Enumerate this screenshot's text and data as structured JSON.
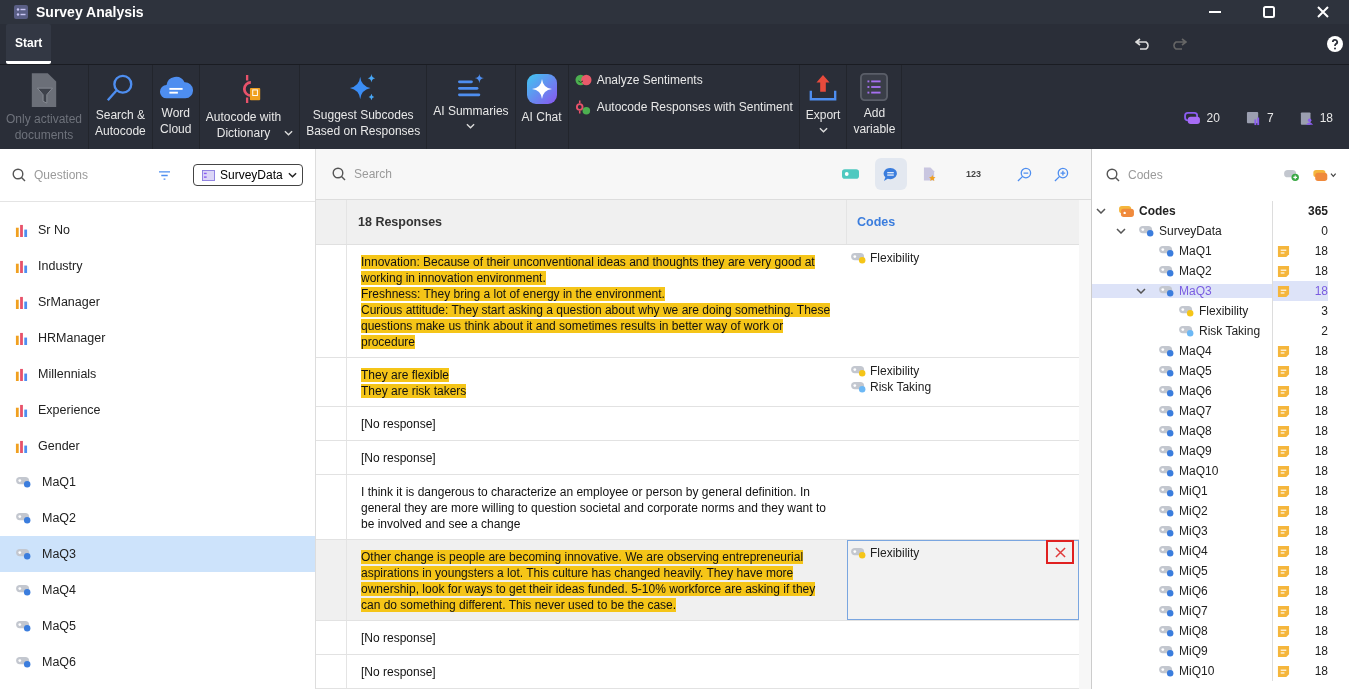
{
  "window": {
    "title": "Survey Analysis"
  },
  "tabs": [
    {
      "label": "Start",
      "selected": true
    }
  ],
  "ribbon": [
    {
      "kind": "big",
      "label": "Only activated\ndocuments",
      "disabled": true,
      "dropdown": false
    },
    {
      "kind": "big",
      "label": "Search &\nAutocode",
      "disabled": false,
      "dropdown": false
    },
    {
      "kind": "big",
      "label": "Word\nCloud",
      "disabled": false,
      "dropdown": false
    },
    {
      "kind": "big",
      "label": "Autocode with\nDictionary",
      "disabled": false,
      "dropdown": true
    },
    {
      "kind": "big",
      "label": "Suggest Subcodes\nBased on Responses",
      "disabled": false,
      "dropdown": false
    },
    {
      "kind": "big",
      "label": "AI Summaries",
      "disabled": false,
      "dropdown": true
    },
    {
      "kind": "big",
      "label": "AI Chat",
      "disabled": false,
      "dropdown": false
    },
    {
      "kind": "stack",
      "items": [
        "Analyze Sentiments",
        "Autocode Responses with Sentiment"
      ]
    },
    {
      "kind": "big",
      "label": "Export",
      "disabled": false,
      "dropdown": true
    },
    {
      "kind": "big",
      "label": "Add\nvariable",
      "disabled": false,
      "dropdown": false
    }
  ],
  "stats": [
    "20",
    "7",
    "18"
  ],
  "left_panel": {
    "search": {
      "placeholder": "Questions"
    },
    "dropdown": "SurveyData",
    "items": [
      {
        "label": "Sr No",
        "kind": "variable",
        "selected": false
      },
      {
        "label": "Industry",
        "kind": "variable",
        "selected": false
      },
      {
        "label": "SrManager",
        "kind": "variable",
        "selected": false
      },
      {
        "label": "HRManager",
        "kind": "variable",
        "selected": false
      },
      {
        "label": "Millennials",
        "kind": "variable",
        "selected": false
      },
      {
        "label": "Experience",
        "kind": "variable",
        "selected": false
      },
      {
        "label": "Gender",
        "kind": "variable",
        "selected": false
      },
      {
        "label": "MaQ1",
        "kind": "code",
        "selected": false
      },
      {
        "label": "MaQ2",
        "kind": "code",
        "selected": false
      },
      {
        "label": "MaQ3",
        "kind": "code",
        "selected": true
      },
      {
        "label": "MaQ4",
        "kind": "code",
        "selected": false
      },
      {
        "label": "MaQ5",
        "kind": "code",
        "selected": false
      },
      {
        "label": "MaQ6",
        "kind": "code",
        "selected": false
      }
    ]
  },
  "responses": {
    "search": {
      "placeholder": "Search"
    },
    "count_button": "123",
    "columns": [
      "18 Responses",
      "Codes"
    ],
    "rows": [
      {
        "coded": true,
        "selected": false,
        "lines": [
          "Innovation: Because of their unconventional ideas and thoughts they are very good at working in innovation environment.",
          "Freshness:  They bring a lot of energy in the environment.",
          "Curious attitude: They start asking a question about why we are doing something. These questions make us think about it and sometimes results in better way of work or procedure"
        ],
        "codes": [
          {
            "label": "Flexibility",
            "color": "#f5c518"
          }
        ]
      },
      {
        "coded": true,
        "selected": false,
        "lines": [
          "They are flexible",
          "They are risk takers"
        ],
        "codes": [
          {
            "label": "Flexibility",
            "color": "#f5c518"
          },
          {
            "label": "Risk Taking",
            "color": "#6cb8f5"
          }
        ]
      },
      {
        "coded": false,
        "selected": false,
        "lines": [
          "[No response]"
        ],
        "codes": []
      },
      {
        "coded": false,
        "selected": false,
        "lines": [
          "[No response]"
        ],
        "codes": []
      },
      {
        "coded": false,
        "selected": false,
        "lines": [
          "I think it is dangerous to characterize an employee or person by general definition. In general they are more willing to question societal and corporate  norms and they want to be involved and see a change"
        ],
        "codes": []
      },
      {
        "coded": true,
        "selected": true,
        "lines": [
          "Other change is people are becoming innovative. We are observing entrepreneurial aspirations in youngsters a lot. This culture has changed heavily. They have more ownership, look for ways to get their ideas funded. 5-10% workforce are asking if they can do something different. This never used to be the case."
        ],
        "codes": [
          {
            "label": "Flexibility",
            "color": "#f5c518"
          }
        ]
      },
      {
        "coded": false,
        "selected": false,
        "lines": [
          "[No response]"
        ],
        "codes": []
      },
      {
        "coded": false,
        "selected": false,
        "lines": [
          "[No response]"
        ],
        "codes": []
      }
    ]
  },
  "codes_panel": {
    "search": {
      "placeholder": "Codes"
    },
    "tree": [
      {
        "label": "Codes",
        "kind": "root",
        "count": "365",
        "expanded": true,
        "selected": false,
        "memo": false,
        "children": [
          {
            "label": "SurveyData",
            "kind": "code",
            "color": "#3b7ddd",
            "count": "0",
            "expanded": true,
            "selected": false,
            "memo": false,
            "children": [
              {
                "label": "MaQ1",
                "kind": "code",
                "color": "#3b7ddd",
                "count": "18",
                "selected": false,
                "memo": true
              },
              {
                "label": "MaQ2",
                "kind": "code",
                "color": "#3b7ddd",
                "count": "18",
                "selected": false,
                "memo": true
              },
              {
                "label": "MaQ3",
                "kind": "code",
                "color": "#3b7ddd",
                "count": "18",
                "expanded": true,
                "selected": true,
                "memo": true,
                "children": [
                  {
                    "label": "Flexibility",
                    "kind": "code",
                    "color": "#f5c518",
                    "count": "3",
                    "selected": false,
                    "memo": false
                  },
                  {
                    "label": "Risk Taking",
                    "kind": "code",
                    "color": "#6cb8f5",
                    "count": "2",
                    "selected": false,
                    "memo": false
                  }
                ]
              },
              {
                "label": "MaQ4",
                "kind": "code",
                "color": "#3b7ddd",
                "count": "18",
                "selected": false,
                "memo": true
              },
              {
                "label": "MaQ5",
                "kind": "code",
                "color": "#3b7ddd",
                "count": "18",
                "selected": false,
                "memo": true
              },
              {
                "label": "MaQ6",
                "kind": "code",
                "color": "#3b7ddd",
                "count": "18",
                "selected": false,
                "memo": true
              },
              {
                "label": "MaQ7",
                "kind": "code",
                "color": "#3b7ddd",
                "count": "18",
                "selected": false,
                "memo": true
              },
              {
                "label": "MaQ8",
                "kind": "code",
                "color": "#3b7ddd",
                "count": "18",
                "selected": false,
                "memo": true
              },
              {
                "label": "MaQ9",
                "kind": "code",
                "color": "#3b7ddd",
                "count": "18",
                "selected": false,
                "memo": true
              },
              {
                "label": "MaQ10",
                "kind": "code",
                "color": "#3b7ddd",
                "count": "18",
                "selected": false,
                "memo": true
              },
              {
                "label": "MiQ1",
                "kind": "code",
                "color": "#3b7ddd",
                "count": "18",
                "selected": false,
                "memo": true
              },
              {
                "label": "MiQ2",
                "kind": "code",
                "color": "#3b7ddd",
                "count": "18",
                "selected": false,
                "memo": true
              },
              {
                "label": "MiQ3",
                "kind": "code",
                "color": "#3b7ddd",
                "count": "18",
                "selected": false,
                "memo": true
              },
              {
                "label": "MiQ4",
                "kind": "code",
                "color": "#3b7ddd",
                "count": "18",
                "selected": false,
                "memo": true
              },
              {
                "label": "MiQ5",
                "kind": "code",
                "color": "#3b7ddd",
                "count": "18",
                "selected": false,
                "memo": true
              },
              {
                "label": "MiQ6",
                "kind": "code",
                "color": "#3b7ddd",
                "count": "18",
                "selected": false,
                "memo": true
              },
              {
                "label": "MiQ7",
                "kind": "code",
                "color": "#3b7ddd",
                "count": "18",
                "selected": false,
                "memo": true
              },
              {
                "label": "MiQ8",
                "kind": "code",
                "color": "#3b7ddd",
                "count": "18",
                "selected": false,
                "memo": true
              },
              {
                "label": "MiQ9",
                "kind": "code",
                "color": "#3b7ddd",
                "count": "18",
                "selected": false,
                "memo": true
              },
              {
                "label": "MiQ10",
                "kind": "code",
                "color": "#3b7ddd",
                "count": "18",
                "selected": false,
                "memo": true
              }
            ]
          }
        ]
      }
    ]
  }
}
